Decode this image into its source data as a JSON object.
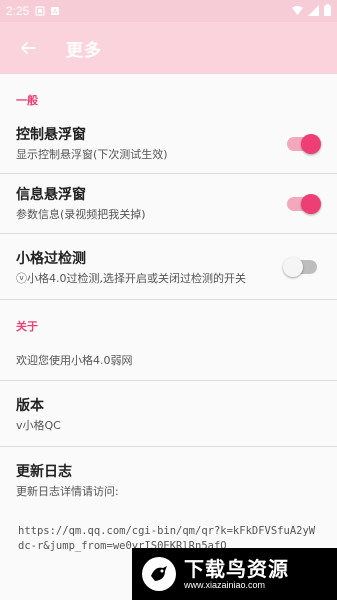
{
  "statusbar": {
    "time": "2:25"
  },
  "appbar": {
    "title": "更多"
  },
  "sections": {
    "general": "一般",
    "about": "关于"
  },
  "prefs": {
    "float_control": {
      "title": "控制悬浮窗",
      "summary": "显示控制悬浮窗(下次测试生效)",
      "enabled": true
    },
    "float_info": {
      "title": "信息悬浮窗",
      "summary": "参数信息(录视频把我关掉)",
      "enabled": true
    },
    "bypass": {
      "title": "小格过检测",
      "summary": "ⓥ小格4.0过检测,选择开启或关闭过检测的开关",
      "enabled": false
    }
  },
  "about": {
    "welcome": "欢迎您使用小格4.0弱网",
    "version_title": "版本",
    "version_value": "v小格QC",
    "changelog_title": "更新日志",
    "changelog_summary": "更新日志详情请访问:",
    "changelog_url": "https://qm.qq.com/cgi-bin/qm/qr?k=kFkDFVSfuA2yWdc-r&jump_from=we0yrIS0EKRlRn5afO"
  },
  "watermark": {
    "name": "下载鸟资源",
    "url": "www.xiazainiao.com"
  },
  "colors": {
    "accent": "#ee3e76",
    "appbar": "#fbd3dc"
  }
}
